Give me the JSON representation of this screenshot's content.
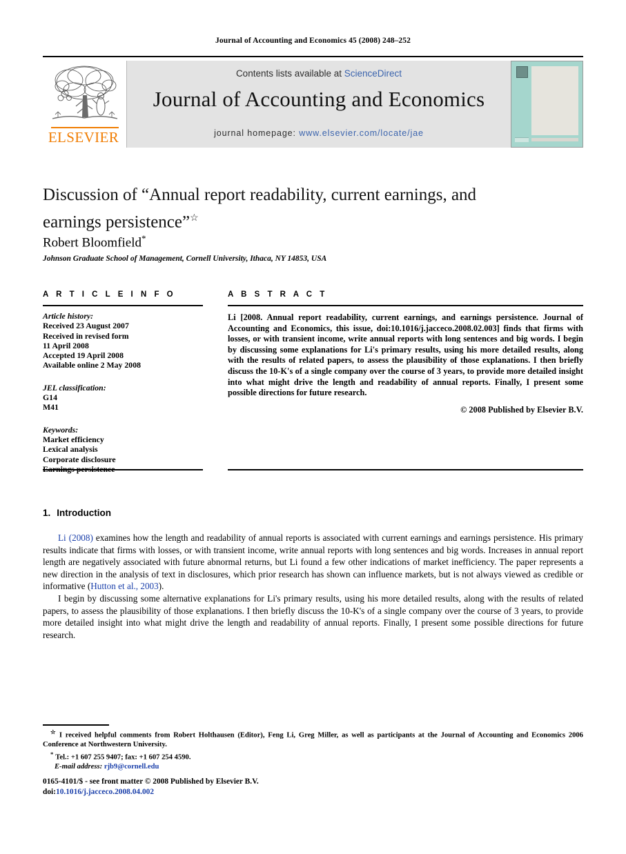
{
  "running_head": "Journal of Accounting and Economics 45 (2008) 248–252",
  "masthead": {
    "publisher_name": "ELSEVIER",
    "contents_prefix": "Contents lists available at ",
    "contents_link": "ScienceDirect",
    "journal_title": "Journal of Accounting and Economics",
    "homepage_prefix": "journal homepage: ",
    "homepage_url": "www.elsevier.com/locate/jae"
  },
  "article": {
    "title": "Discussion of “Annual report readability, current earnings, and earnings persistence”",
    "title_footnote_mark": "☆",
    "author": "Robert Bloomfield",
    "author_footnote_mark": "*",
    "affiliation": "Johnson Graduate School of Management, Cornell University, Ithaca, NY 14853, USA"
  },
  "article_info": {
    "heading": "A R T I C L E   I N F O",
    "history_label": "Article history:",
    "history": [
      "Received 23 August 2007",
      "Received in revised form",
      "11 April 2008",
      "Accepted 19 April 2008",
      "Available online 2 May 2008"
    ],
    "jel_label": "JEL classification:",
    "jel_codes": [
      "G14",
      "M41"
    ],
    "keywords_label": "Keywords:",
    "keywords": [
      "Market efficiency",
      "Lexical analysis",
      "Corporate disclosure",
      "Earnings persistence"
    ]
  },
  "abstract": {
    "heading": "A B S T R A C T",
    "text": "Li [2008. Annual report readability, current earnings, and earnings persistence. Journal of Accounting and Economics, this issue, doi:10.1016/j.jacceco.2008.02.003] finds that firms with losses, or with transient income, write annual reports with long sentences and big words. I begin by discussing some explanations for Li's primary results, using his more detailed results, along with the results of related papers, to assess the plausibility of those explanations. I then briefly discuss the 10-K's of a single company over the course of 3 years, to provide more detailed insight into what might drive the length and readability of annual reports. Finally, I present some possible directions for future research.",
    "copyright": "© 2008 Published by Elsevier B.V."
  },
  "introduction": {
    "number": "1.",
    "heading": "Introduction",
    "para1_link1": "Li (2008)",
    "para1_a": " examines how the length and readability of annual reports is associated with current earnings and earnings persistence. His primary results indicate that firms with losses, or with transient income, write annual reports with long sentences and big words. Increases in annual report length are negatively associated with future abnormal returns, but Li found a few other indications of market inefficiency. The paper represents a new direction in the analysis of text in disclosures, which prior research has shown can influence markets, but is not always viewed as credible or informative (",
    "para1_link2": "Hutton et al., 2003",
    "para1_b": ").",
    "para2": "I begin by discussing some alternative explanations for Li's primary results, using his more detailed results, along with the results of related papers, to assess the plausibility of those explanations. I then briefly discuss the 10-K's of a single company over the course of 3 years, to provide more detailed insight into what might drive the length and readability of annual reports. Finally, I present some possible directions for future research."
  },
  "footnotes": {
    "star_mark": "☆",
    "star_text": "I received helpful comments from Robert Holthausen (Editor), Feng Li, Greg Miller, as well as participants at the Journal of Accounting and Economics 2006 Conference at Northwestern University.",
    "tel_mark": "*",
    "tel_text": "Tel.: +1 607 255 9407; fax: +1 607 254 4590.",
    "email_label": "E-mail address:",
    "email_value": "rjb9@cornell.edu"
  },
  "colophon": {
    "front_matter": "0165-4101/$ - see front matter © 2008 Published by Elsevier B.V.",
    "doi_label": "doi:",
    "doi_value": "10.1016/j.jacceco.2008.04.002"
  },
  "colors": {
    "link": "#1a3faa",
    "elsevier_orange": "#f07c00",
    "banner_gray": "#e3e3e3",
    "cover_teal": "#a5d6cd"
  }
}
